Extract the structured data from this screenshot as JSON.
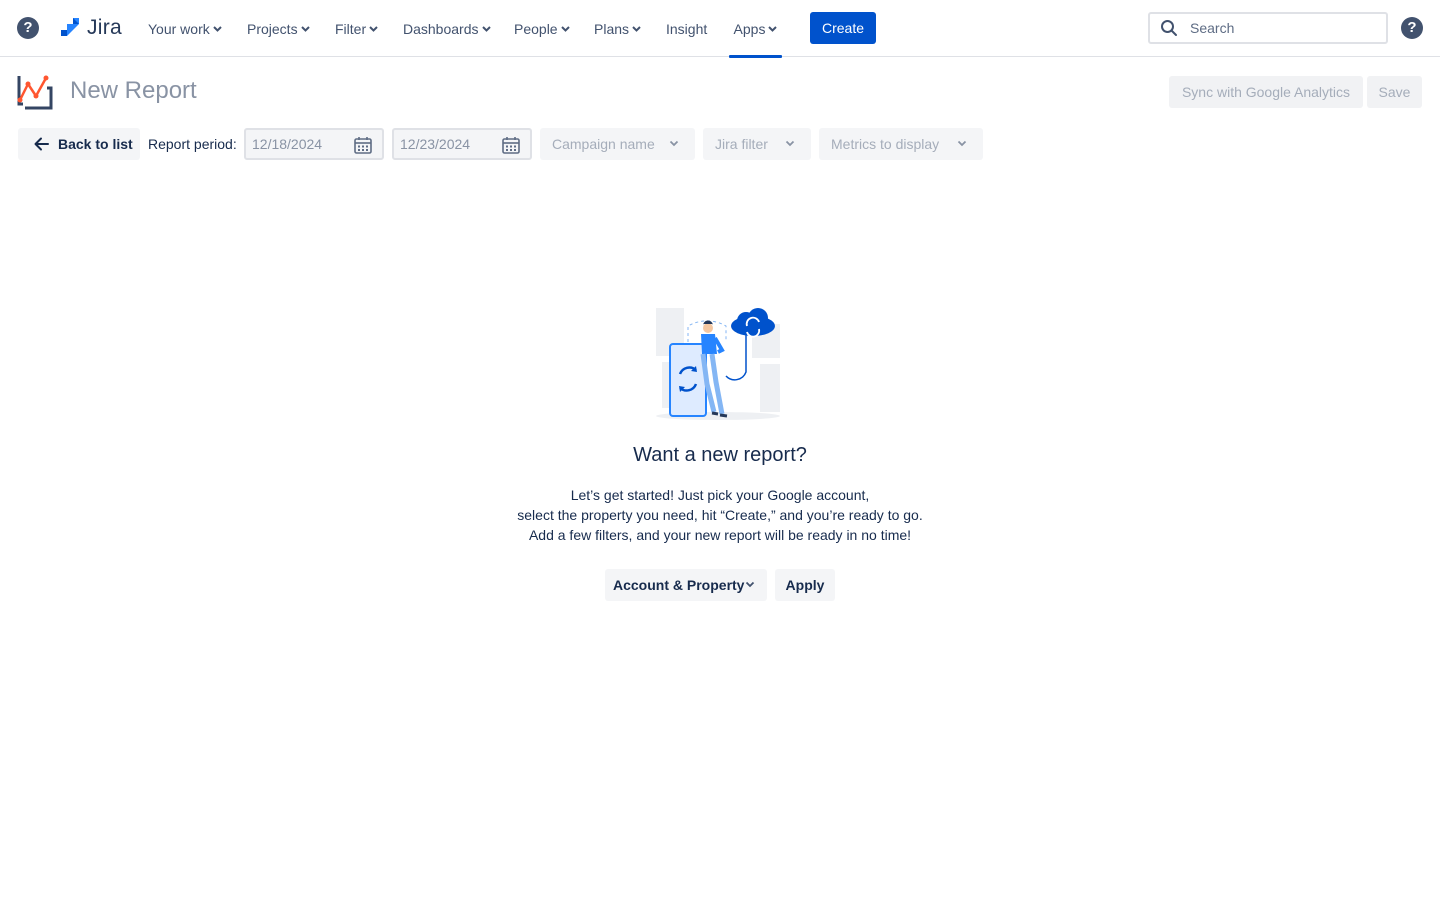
{
  "nav": {
    "help_left": "?",
    "logo_text": "Jira",
    "items": [
      {
        "label": "Your work",
        "dropdown": true
      },
      {
        "label": "Projects",
        "dropdown": true
      },
      {
        "label": "Filter",
        "dropdown": true
      },
      {
        "label": "Dashboards",
        "dropdown": true
      },
      {
        "label": "People",
        "dropdown": true
      },
      {
        "label": "Plans",
        "dropdown": true
      },
      {
        "label": "Insight",
        "dropdown": false
      },
      {
        "label": "Apps",
        "dropdown": true,
        "active": true
      }
    ],
    "create_label": "Create",
    "search_placeholder": "Search",
    "help_right": "?"
  },
  "header": {
    "title": "New Report",
    "sync_label": "Sync with Google Analytics",
    "save_label": "Save"
  },
  "toolbar": {
    "back_label": "Back to list",
    "period_label": "Report period:",
    "start_date": "12/18/2024",
    "end_date": "12/23/2024",
    "campaign_label": "Campaign name",
    "jira_filter_label": "Jira filter",
    "metrics_label": "Metrics to display"
  },
  "empty_state": {
    "title": "Want a new report?",
    "lines": [
      "Let’s get started! Just pick your Google account,",
      "select the property you need, hit “Create,” and you’re ready to go.",
      "Add a few filters, and your new report will be ready in no time!"
    ],
    "account_label": "Account & Property",
    "apply_label": "Apply"
  },
  "colors": {
    "primary": "#0052cc",
    "text": "#172b4d",
    "muted": "#8993a4",
    "brand_orange": "#ff5630"
  },
  "icons": {
    "help": "question-circle-icon",
    "logo": "jira-logo-icon",
    "search": "search-icon",
    "back": "arrow-left-icon",
    "calendar": "calendar-icon",
    "chevron": "chevron-down-icon",
    "report_logo": "report-chart-icon"
  }
}
